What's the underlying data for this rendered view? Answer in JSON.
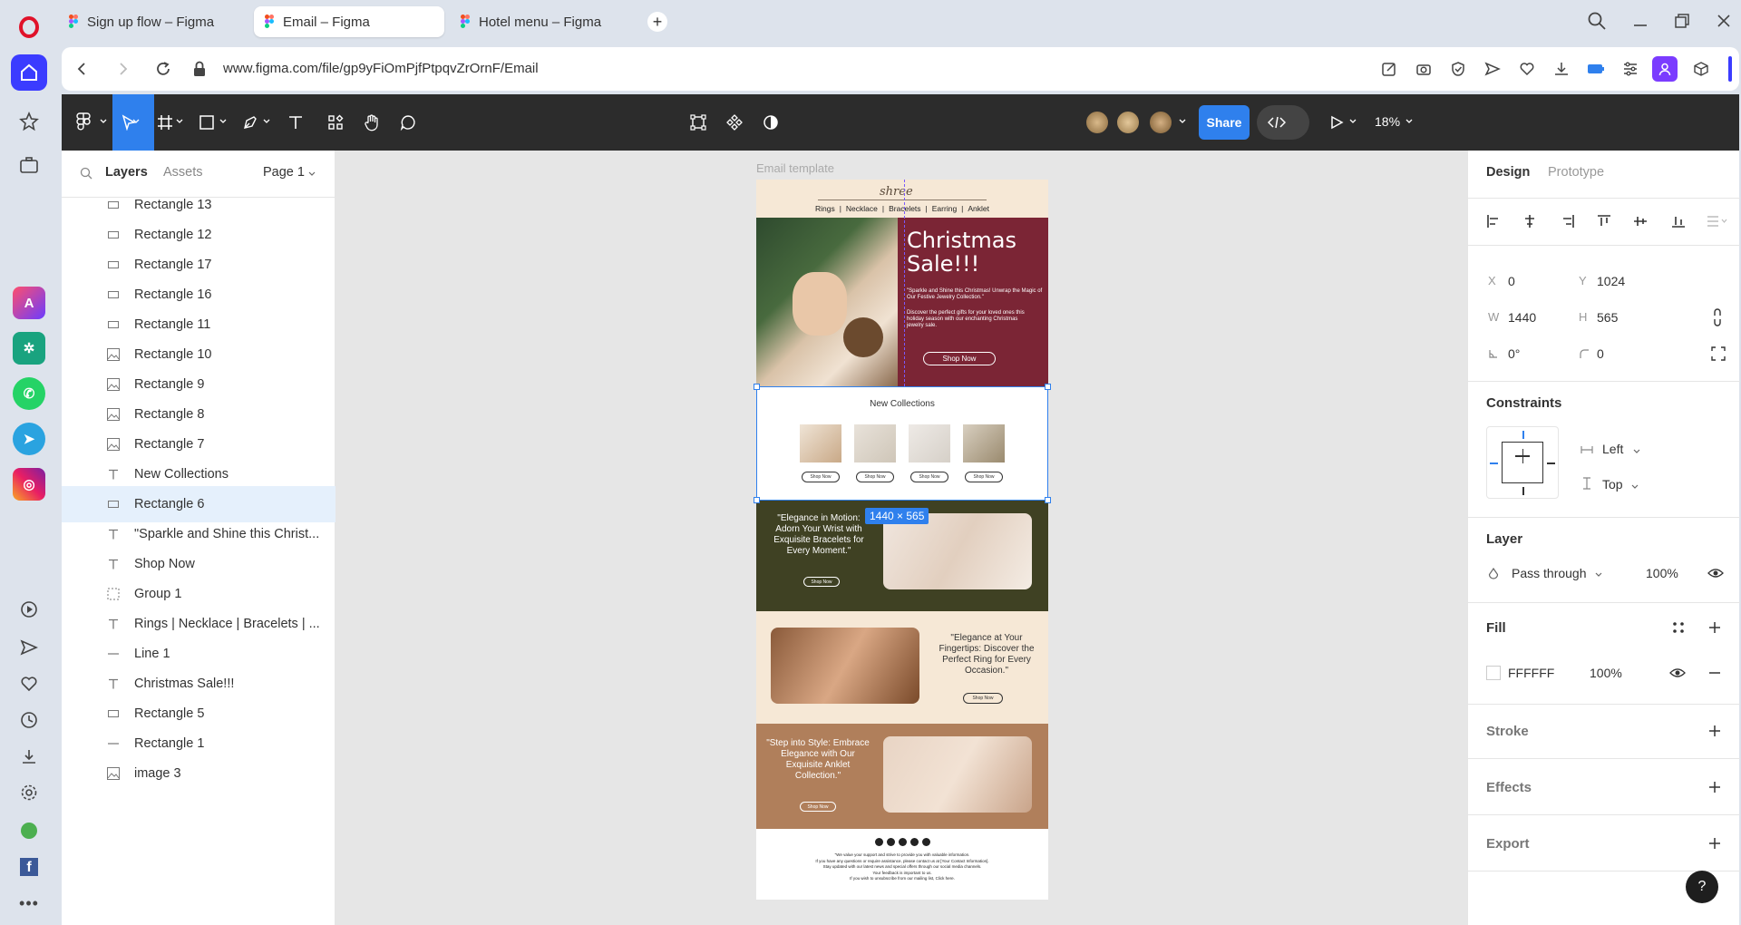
{
  "tabs": [
    {
      "title": "Sign up flow – Figma",
      "active": false
    },
    {
      "title": "Email – Figma",
      "active": true
    },
    {
      "title": "Hotel menu – Figma",
      "active": false
    }
  ],
  "address": {
    "url": "www.figma.com/file/gp9yFiOmPjfPtpqvZrOrnF/Email"
  },
  "toolbar": {
    "share_label": "Share",
    "zoom_label": "18%"
  },
  "layers_panel": {
    "tab_layers": "Layers",
    "tab_assets": "Assets",
    "page_label": "Page 1",
    "items": [
      {
        "name": "Rectangle 13",
        "icon": "rectangle-icon"
      },
      {
        "name": "Rectangle 12",
        "icon": "rectangle-icon"
      },
      {
        "name": "Rectangle 17",
        "icon": "rectangle-icon"
      },
      {
        "name": "Rectangle 16",
        "icon": "rectangle-icon"
      },
      {
        "name": "Rectangle 11",
        "icon": "rectangle-icon"
      },
      {
        "name": "Rectangle 10",
        "icon": "image-icon"
      },
      {
        "name": "Rectangle 9",
        "icon": "image-icon"
      },
      {
        "name": "Rectangle 8",
        "icon": "image-icon"
      },
      {
        "name": "Rectangle 7",
        "icon": "image-icon"
      },
      {
        "name": "New Collections",
        "icon": "text-icon"
      },
      {
        "name": "Rectangle 6",
        "icon": "rectangle-icon",
        "selected": true
      },
      {
        "name": "\"Sparkle and Shine this Christ...",
        "icon": "text-icon"
      },
      {
        "name": "Shop Now",
        "icon": "text-icon"
      },
      {
        "name": "Group 1",
        "icon": "group-icon"
      },
      {
        "name": "Rings | Necklace | Bracelets | ...",
        "icon": "text-icon"
      },
      {
        "name": "Line 1",
        "icon": "line-icon"
      },
      {
        "name": "Christmas Sale!!!",
        "icon": "text-icon"
      },
      {
        "name": "Rectangle 5",
        "icon": "rectangle-icon"
      },
      {
        "name": "Rectangle 1",
        "icon": "line-icon"
      },
      {
        "name": "image 3",
        "icon": "image-icon"
      }
    ]
  },
  "canvas": {
    "frame_label": "Email template",
    "selection_size": "1440 × 565",
    "email": {
      "brand": "shree",
      "nav": [
        "Rings",
        "|",
        "Necklace",
        "|",
        "Bracelets",
        "|",
        "Earring",
        "|",
        "Anklet"
      ],
      "hero_title_1": "Christmas",
      "hero_title_2": "Sale!!!",
      "hero_quote": "\"Sparkle and Shine this Christmas! Unwrap the Magic of Our Festive Jewelry Collection.\"",
      "hero_body": "Discover the perfect gifts for your loved ones this holiday season with our enchanting Christmas jewelry sale.",
      "hero_button": "Shop Now",
      "collections_title": "New Collections",
      "mini_button": "Shop Now",
      "bracelets_text": "\"Elegance in Motion: Adorn Your Wrist with Exquisite Bracelets for Every Moment.\"",
      "rings_text": "\"Elegance at Your Fingertips: Discover the Perfect Ring for Every Occasion.\"",
      "anklet_text": "\"Step into Style: Embrace Elegance with Our Exquisite Anklet Collection.\"",
      "footer_lines": [
        "\"We value your support and strive to provide you with valuable information.",
        "If you have any questions or require assistance, please contact us at [Your Contact Information].",
        "Stay updated with our latest news and special offers through our social media channels.",
        "Your feedback is important to us.",
        "If you wish to unsubscribe from our mailing list, Click here."
      ]
    }
  },
  "design_panel": {
    "tab_design": "Design",
    "tab_prototype": "Prototype",
    "x_label": "X",
    "x_value": "0",
    "y_label": "Y",
    "y_value": "1024",
    "w_label": "W",
    "w_value": "1440",
    "h_label": "H",
    "h_value": "565",
    "rotation_value": "0°",
    "radius_value": "0",
    "constraints_title": "Constraints",
    "constraint_h": "Left",
    "constraint_v": "Top",
    "layer_title": "Layer",
    "blend_mode": "Pass through",
    "layer_opacity": "100%",
    "fill_title": "Fill",
    "fill_hex": "FFFFFF",
    "fill_opacity": "100%",
    "stroke_title": "Stroke",
    "effects_title": "Effects",
    "export_title": "Export",
    "help_label": "?"
  },
  "colors": {
    "accent": "#2f80ed",
    "toolbar_bg": "#2c2c2c",
    "hero_maroon": "#7b2535",
    "olive": "#3f4123",
    "cream": "#f6e8d6",
    "tan": "#b07f5b"
  }
}
